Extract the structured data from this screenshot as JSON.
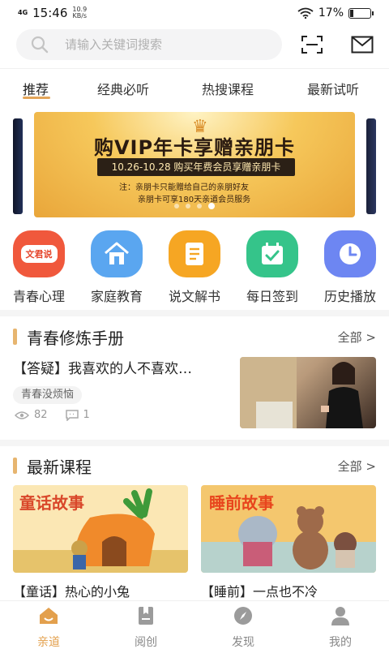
{
  "status_bar": {
    "network": "4G",
    "time": "15:46",
    "speed_value": "10.9",
    "speed_unit": "KB/s",
    "battery_text": "17%",
    "battery_level": 0.17
  },
  "search": {
    "placeholder": "请输入关键词搜索"
  },
  "icons": {
    "search": "search-icon",
    "scan": "scan-icon",
    "mail": "mail-icon"
  },
  "tabs": [
    {
      "label": "推荐",
      "active": true
    },
    {
      "label": "经典必听",
      "active": false
    },
    {
      "label": "热搜课程",
      "active": false
    },
    {
      "label": "最新试听",
      "active": false
    }
  ],
  "banner": {
    "title": "购VIP年卡享赠亲朋卡",
    "date_line": "10.26-10.28 购买年费会员享赠亲朋卡",
    "note1": "注：亲朋卡只能赠给自己的亲朋好友",
    "note2": "亲朋卡可享180天亲道会员服务",
    "dot_count": 4,
    "active_dot": 3
  },
  "quick_links": [
    {
      "label": "青春心理",
      "icon_text": "文君说",
      "icon": "chat-bubble-icon",
      "color": "#f0583c"
    },
    {
      "label": "家庭教育",
      "icon": "house-icon",
      "color": "#5aa6f0"
    },
    {
      "label": "说文解书",
      "icon": "book-icon",
      "color": "#f6a623"
    },
    {
      "label": "每日签到",
      "icon": "calendar-check-icon",
      "color": "#35c48a"
    },
    {
      "label": "历史播放",
      "icon": "clock-icon",
      "color": "#6d86f2"
    }
  ],
  "section_youth": {
    "title": "青春修炼手册",
    "more": "全部 >",
    "article": {
      "title": "【答疑】我喜欢的人不喜欢…",
      "tag": "青春没烦恼",
      "views": "82",
      "comments": "1"
    }
  },
  "section_latest": {
    "title": "最新课程",
    "more": "全部 >",
    "courses": [
      {
        "title": "【童话】热心的小兔",
        "cover_text": "童话故事"
      },
      {
        "title": "【睡前】一点也不冷",
        "cover_text": "睡前故事"
      }
    ]
  },
  "bottom_nav": [
    {
      "label": "亲道",
      "icon": "home-icon",
      "active": true
    },
    {
      "label": "阅创",
      "icon": "bookmark-icon",
      "active": false
    },
    {
      "label": "发现",
      "icon": "compass-icon",
      "active": false
    },
    {
      "label": "我的",
      "icon": "person-icon",
      "active": false
    }
  ],
  "colors": {
    "accent": "#e3a55a",
    "section_bar": "#e7b56f",
    "nav_active": "#e3a04d"
  }
}
